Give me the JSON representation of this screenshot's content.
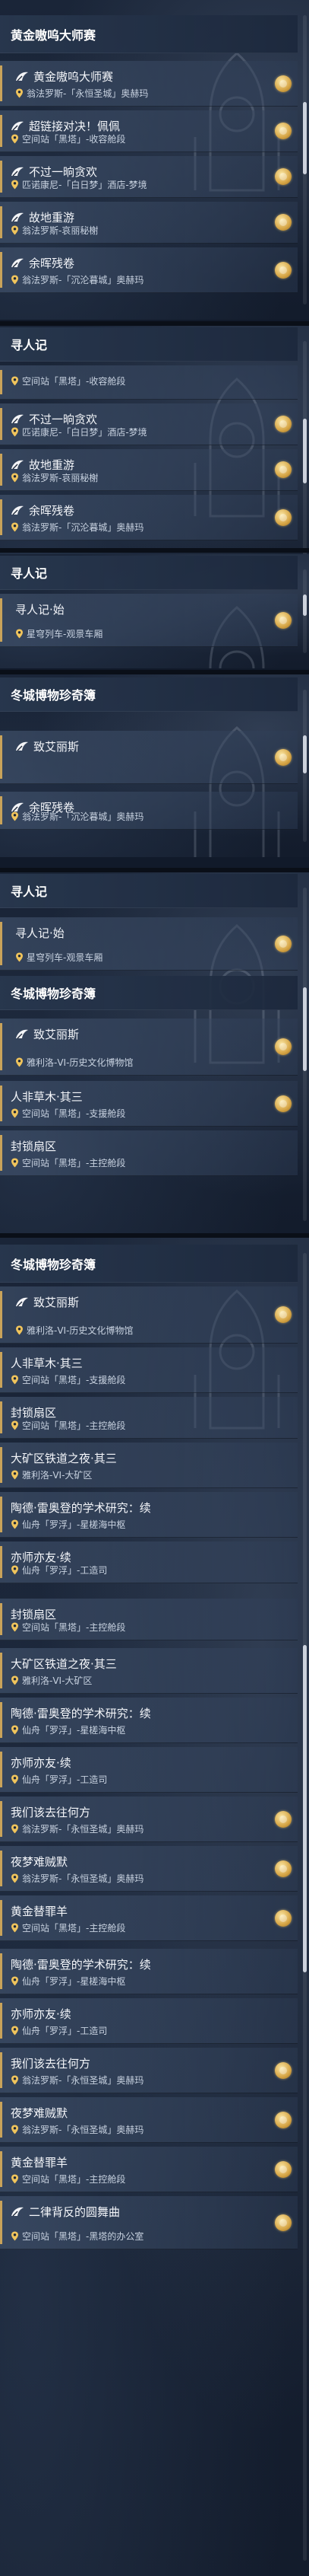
{
  "titles": {
    "golden_master": "黄金嗷呜大师赛",
    "seek_person": "寻人记",
    "museum": "冬城博物珍奇簿"
  },
  "locations": {
    "anfa_eternal": "翁法罗斯-「永恒圣城」奥赫玛",
    "station_collect": "空间站「黑塔」-收容舱段",
    "penacony_hotel": "匹诺康尼-「白日梦」酒店-梦境",
    "anfa_mist": "翁法罗斯-哀丽秘榭",
    "anfa_sunken": "翁法罗斯-「沉沦暮城」奥赫玛",
    "express_car": "星穹列车-观景车厢",
    "jarilo_museum": "雅利洛-VI-历史文化博物馆",
    "station_support": "空间站「黑塔」-支援舱段",
    "station_control": "空间站「黑塔」-主控舱段",
    "jarilo_mine": "雅利洛-VI-大矿区",
    "xianzhou_star": "仙舟「罗浮」-星槎海中枢",
    "xianzhou_workshop": "仙舟「罗浮」-工造司",
    "station_office": "空间站「黑塔」-黑塔的办公室"
  },
  "quests": {
    "golden_master": "黄金嗷呜大师赛",
    "super_link": "超链接对决！佩佩",
    "not_feast": "不过一晌贪欢",
    "homeland": "故地重游",
    "embers": "余晖残卷",
    "seek_start": "寻人记·始",
    "zhiai": "致艾丽斯",
    "inhuman": "人非草木·其三",
    "lockdown": "封锁扇区",
    "railway": "大矿区铁道之夜·其三",
    "tao_de": "陶德·雷奥登的学术研究：续",
    "teacher": "亦师亦友·续",
    "where_go": "我们该去往何方",
    "nightmare": "夜梦难贼默",
    "scapegoat": "黄金替罪羊",
    "rondo": "二律背反的圆舞曲"
  }
}
